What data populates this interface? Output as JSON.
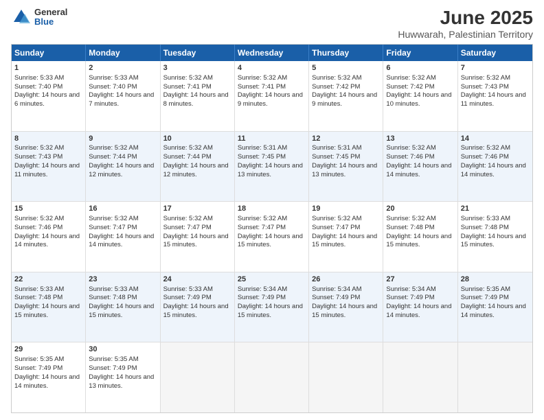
{
  "header": {
    "logo_general": "General",
    "logo_blue": "Blue",
    "title": "June 2025",
    "subtitle": "Huwwarah, Palestinian Territory"
  },
  "weekdays": [
    "Sunday",
    "Monday",
    "Tuesday",
    "Wednesday",
    "Thursday",
    "Friday",
    "Saturday"
  ],
  "rows": [
    {
      "alt": false,
      "cells": [
        {
          "day": "1",
          "content": "Sunrise: 5:33 AM\nSunset: 7:40 PM\nDaylight: 14 hours and 6 minutes."
        },
        {
          "day": "2",
          "content": "Sunrise: 5:33 AM\nSunset: 7:40 PM\nDaylight: 14 hours and 7 minutes."
        },
        {
          "day": "3",
          "content": "Sunrise: 5:32 AM\nSunset: 7:41 PM\nDaylight: 14 hours and 8 minutes."
        },
        {
          "day": "4",
          "content": "Sunrise: 5:32 AM\nSunset: 7:41 PM\nDaylight: 14 hours and 9 minutes."
        },
        {
          "day": "5",
          "content": "Sunrise: 5:32 AM\nSunset: 7:42 PM\nDaylight: 14 hours and 9 minutes."
        },
        {
          "day": "6",
          "content": "Sunrise: 5:32 AM\nSunset: 7:42 PM\nDaylight: 14 hours and 10 minutes."
        },
        {
          "day": "7",
          "content": "Sunrise: 5:32 AM\nSunset: 7:43 PM\nDaylight: 14 hours and 11 minutes."
        }
      ]
    },
    {
      "alt": true,
      "cells": [
        {
          "day": "8",
          "content": "Sunrise: 5:32 AM\nSunset: 7:43 PM\nDaylight: 14 hours and 11 minutes."
        },
        {
          "day": "9",
          "content": "Sunrise: 5:32 AM\nSunset: 7:44 PM\nDaylight: 14 hours and 12 minutes."
        },
        {
          "day": "10",
          "content": "Sunrise: 5:32 AM\nSunset: 7:44 PM\nDaylight: 14 hours and 12 minutes."
        },
        {
          "day": "11",
          "content": "Sunrise: 5:31 AM\nSunset: 7:45 PM\nDaylight: 14 hours and 13 minutes."
        },
        {
          "day": "12",
          "content": "Sunrise: 5:31 AM\nSunset: 7:45 PM\nDaylight: 14 hours and 13 minutes."
        },
        {
          "day": "13",
          "content": "Sunrise: 5:32 AM\nSunset: 7:46 PM\nDaylight: 14 hours and 14 minutes."
        },
        {
          "day": "14",
          "content": "Sunrise: 5:32 AM\nSunset: 7:46 PM\nDaylight: 14 hours and 14 minutes."
        }
      ]
    },
    {
      "alt": false,
      "cells": [
        {
          "day": "15",
          "content": "Sunrise: 5:32 AM\nSunset: 7:46 PM\nDaylight: 14 hours and 14 minutes."
        },
        {
          "day": "16",
          "content": "Sunrise: 5:32 AM\nSunset: 7:47 PM\nDaylight: 14 hours and 14 minutes."
        },
        {
          "day": "17",
          "content": "Sunrise: 5:32 AM\nSunset: 7:47 PM\nDaylight: 14 hours and 15 minutes."
        },
        {
          "day": "18",
          "content": "Sunrise: 5:32 AM\nSunset: 7:47 PM\nDaylight: 14 hours and 15 minutes."
        },
        {
          "day": "19",
          "content": "Sunrise: 5:32 AM\nSunset: 7:47 PM\nDaylight: 14 hours and 15 minutes."
        },
        {
          "day": "20",
          "content": "Sunrise: 5:32 AM\nSunset: 7:48 PM\nDaylight: 14 hours and 15 minutes."
        },
        {
          "day": "21",
          "content": "Sunrise: 5:33 AM\nSunset: 7:48 PM\nDaylight: 14 hours and 15 minutes."
        }
      ]
    },
    {
      "alt": true,
      "cells": [
        {
          "day": "22",
          "content": "Sunrise: 5:33 AM\nSunset: 7:48 PM\nDaylight: 14 hours and 15 minutes."
        },
        {
          "day": "23",
          "content": "Sunrise: 5:33 AM\nSunset: 7:48 PM\nDaylight: 14 hours and 15 minutes."
        },
        {
          "day": "24",
          "content": "Sunrise: 5:33 AM\nSunset: 7:49 PM\nDaylight: 14 hours and 15 minutes."
        },
        {
          "day": "25",
          "content": "Sunrise: 5:34 AM\nSunset: 7:49 PM\nDaylight: 14 hours and 15 minutes."
        },
        {
          "day": "26",
          "content": "Sunrise: 5:34 AM\nSunset: 7:49 PM\nDaylight: 14 hours and 15 minutes."
        },
        {
          "day": "27",
          "content": "Sunrise: 5:34 AM\nSunset: 7:49 PM\nDaylight: 14 hours and 14 minutes."
        },
        {
          "day": "28",
          "content": "Sunrise: 5:35 AM\nSunset: 7:49 PM\nDaylight: 14 hours and 14 minutes."
        }
      ]
    },
    {
      "alt": false,
      "cells": [
        {
          "day": "29",
          "content": "Sunrise: 5:35 AM\nSunset: 7:49 PM\nDaylight: 14 hours and 14 minutes."
        },
        {
          "day": "30",
          "content": "Sunrise: 5:35 AM\nSunset: 7:49 PM\nDaylight: 14 hours and 13 minutes."
        },
        {
          "day": "",
          "content": ""
        },
        {
          "day": "",
          "content": ""
        },
        {
          "day": "",
          "content": ""
        },
        {
          "day": "",
          "content": ""
        },
        {
          "day": "",
          "content": ""
        }
      ]
    }
  ]
}
